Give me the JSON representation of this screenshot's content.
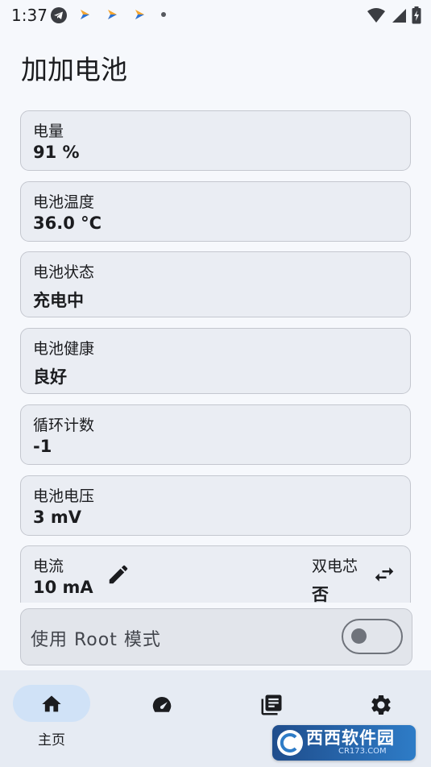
{
  "status_bar": {
    "time": "1:37",
    "icons": [
      "telegram-icon",
      "app-notification-icon",
      "app-notification-icon",
      "app-notification-icon",
      "more-dot-icon",
      "wifi-icon",
      "signal-icon",
      "battery-charging-icon"
    ]
  },
  "page": {
    "title": "加加电池"
  },
  "cards": [
    {
      "label": "电量",
      "value": "91 %"
    },
    {
      "label": "电池温度",
      "value": "36.0 °C"
    },
    {
      "label": "电池状态",
      "value": "充电中"
    },
    {
      "label": "电池健康",
      "value": "良好"
    },
    {
      "label": "循环计数",
      "value": "-1"
    },
    {
      "label": "电池电压",
      "value": "3 mV"
    }
  ],
  "current_card": {
    "label": "电流",
    "value": "10 mA",
    "dual_label": "双电芯",
    "dual_value": "否",
    "edit_icon": "edit-icon",
    "swap_icon": "swap-icon"
  },
  "root_mode": {
    "label": "使用 Root 模式",
    "enabled": false
  },
  "bottom_nav": {
    "items": [
      {
        "icon": "home-icon",
        "label": "主页",
        "active": true
      },
      {
        "icon": "speed-icon",
        "label": "",
        "active": false
      },
      {
        "icon": "library-icon",
        "label": "",
        "active": false
      },
      {
        "icon": "settings-icon",
        "label": "",
        "active": false
      }
    ]
  },
  "watermark": {
    "title": "西西软件园",
    "subtitle": "CR173.COM"
  },
  "colors": {
    "background": "#f6f8fc",
    "card": "#eaedf3",
    "card_border": "#c4c7cf",
    "nav_bar": "#e6ebf3",
    "nav_active": "#d0e2f7",
    "text": "#1b1c1f"
  }
}
